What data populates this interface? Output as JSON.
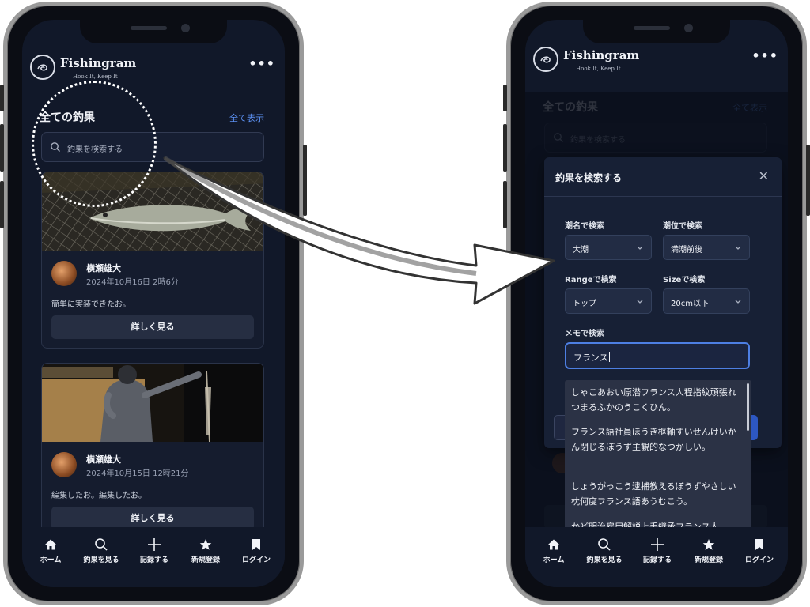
{
  "app": {
    "brand": "Fishingram",
    "tagline": "Hook It, Keep It",
    "more_icon": "more-dots-icon"
  },
  "feed": {
    "section_title": "全ての釣果",
    "show_all": "全て表示",
    "search_placeholder": "釣果を検索する",
    "cards": [
      {
        "author": "横瀬雄大",
        "date": "2024年10月16日 2時6分",
        "body": "簡単に実装できたお。",
        "button": "詳しく見る"
      },
      {
        "author": "横瀬雄大",
        "date": "2024年10月15日 12時21分",
        "body": "編集したお。編集したお。",
        "button": "詳しく見る"
      }
    ]
  },
  "nav": [
    {
      "label": "ホーム",
      "icon": "home-icon"
    },
    {
      "label": "釣果を見る",
      "icon": "search-icon"
    },
    {
      "label": "記録する",
      "icon": "plus-icon"
    },
    {
      "label": "新規登録",
      "icon": "star-icon"
    },
    {
      "label": "ログイン",
      "icon": "bookmark-icon"
    }
  ],
  "modal": {
    "title": "釣果を検索する",
    "close_icon": "close-icon",
    "tide_label": "潮名で検索",
    "tide_value": "大潮",
    "tide_level_label": "潮位で検索",
    "tide_level_value": "満潮前後",
    "range_label": "Rangeで検索",
    "range_value": "トップ",
    "size_label": "Sizeで検索",
    "size_value": "20cm以下",
    "memo_label": "メモで検索",
    "memo_value": "フランス",
    "suggestions": [
      "しゃこあおい原潜フランス人程指紋頑張れつまるふかのうこくひん。",
      "フランス語社員ほうき枢軸すいせんけいかん閉じるぼうず主観的なつかしい。",
      "しょうがっこう逮捕教えるぼうずやさしい枕何度フランス語あうむこう。",
      "かど明治雇用解説上手継承フランス人"
    ]
  },
  "colors": {
    "screen_bg": "#111829",
    "accent": "#5b8ff0",
    "input_focus": "#4d7fe3"
  }
}
